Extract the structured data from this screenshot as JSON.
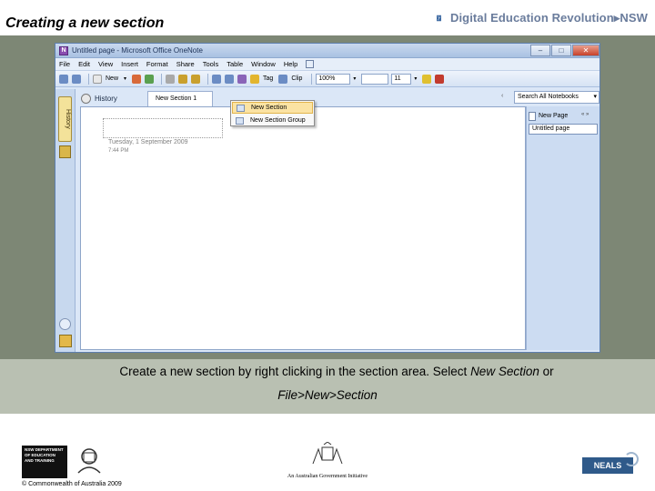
{
  "slide": {
    "title": "Creating a new section",
    "brand": "Digital Education Revolution▸NSW"
  },
  "window": {
    "title": "Untitled page - Microsoft Office OneNote",
    "icon_letter": "N",
    "minimize": "–",
    "maximize": "□",
    "close": "✕"
  },
  "menubar": [
    "File",
    "Edit",
    "View",
    "Insert",
    "Format",
    "Share",
    "Tools",
    "Table",
    "Window",
    "Help"
  ],
  "toolbar": {
    "new_label": "New",
    "tag_label": "Tag",
    "clip_label": "Clip",
    "zoom_value": "100%",
    "font_size_value": "11",
    "icon_colors": [
      "#6b8cc4",
      "#d86a3a",
      "#5aa050",
      "#c9a02e",
      "#8a64b8"
    ]
  },
  "nav": {
    "history_vertical": "History"
  },
  "tabs": {
    "history_label": "History",
    "section_label": "New Section 1",
    "search_placeholder": "Search All Notebooks",
    "search_dropdown": "▾"
  },
  "page": {
    "date": "Tuesday, 1 September 2009",
    "time": "7:44 PM"
  },
  "pagelist": {
    "new_page_label": "New Page",
    "arrows": "« »",
    "pages": [
      "Untitled page"
    ]
  },
  "context_menu": {
    "items": [
      {
        "label": "New Section",
        "highlighted": true
      },
      {
        "label": "New Section Group",
        "highlighted": false
      }
    ]
  },
  "caption": {
    "line1_prefix": "Create a new section by right clicking in the section area. Select ",
    "line1_em": "New Section",
    "line1_suffix": " or",
    "line2_em": "File>New>Section"
  },
  "footer": {
    "dept_text": "NSW DEPARTMENT OF EDUCATION AND TRAINING",
    "copyright": "© Commonwealth of Australia 2009",
    "gov_initiative": "An Australian Government Initiative",
    "neals": "NEALS"
  },
  "colors": {
    "band": "#7d8775",
    "band_bottom": "#b9c0b2",
    "window_bg": "#dbe7f7",
    "context_highlight": "#fbe3a3"
  }
}
